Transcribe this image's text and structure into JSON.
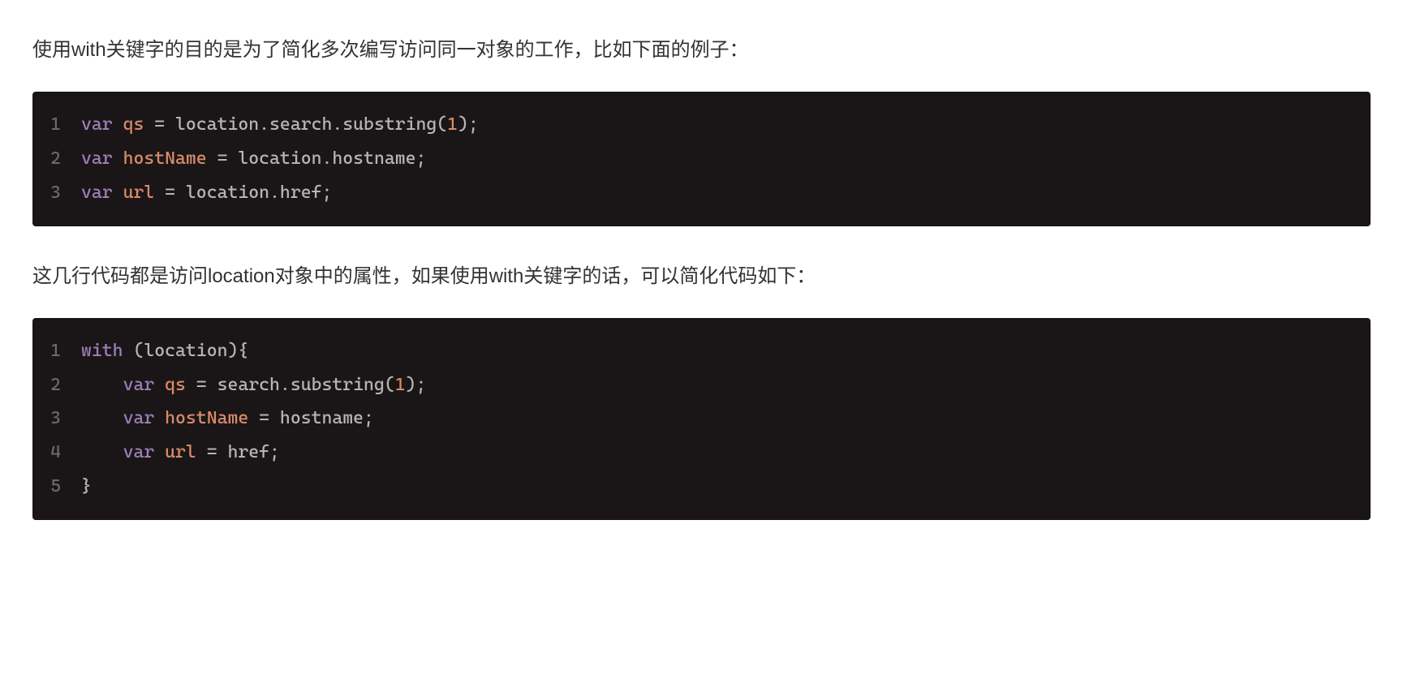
{
  "paragraphs": {
    "p1": "使用with关键字的目的是为了简化多次编写访问同一对象的工作，比如下面的例子：",
    "p2": "这几行代码都是访问location对象中的属性，如果使用with关键字的话，可以简化代码如下："
  },
  "codeblock1": {
    "lines": [
      {
        "num": "1",
        "tokens": [
          {
            "text": "var",
            "class": "keyword"
          },
          {
            "text": " ",
            "class": ""
          },
          {
            "text": "qs",
            "class": "variable"
          },
          {
            "text": " = location.search.substring(",
            "class": "punctuation"
          },
          {
            "text": "1",
            "class": "number"
          },
          {
            "text": ");",
            "class": "punctuation"
          }
        ]
      },
      {
        "num": "2",
        "tokens": [
          {
            "text": "var",
            "class": "keyword"
          },
          {
            "text": " ",
            "class": ""
          },
          {
            "text": "hostName",
            "class": "variable"
          },
          {
            "text": " = location.hostname;",
            "class": "punctuation"
          }
        ]
      },
      {
        "num": "3",
        "tokens": [
          {
            "text": "var",
            "class": "keyword"
          },
          {
            "text": " ",
            "class": ""
          },
          {
            "text": "url",
            "class": "variable"
          },
          {
            "text": " = location.href;",
            "class": "punctuation"
          }
        ]
      }
    ]
  },
  "codeblock2": {
    "lines": [
      {
        "num": "1",
        "tokens": [
          {
            "text": "with",
            "class": "keyword"
          },
          {
            "text": " (location){",
            "class": "punctuation"
          }
        ]
      },
      {
        "num": "2",
        "tokens": [
          {
            "text": "    ",
            "class": ""
          },
          {
            "text": "var",
            "class": "keyword"
          },
          {
            "text": " ",
            "class": ""
          },
          {
            "text": "qs",
            "class": "variable"
          },
          {
            "text": " = search.substring(",
            "class": "punctuation"
          },
          {
            "text": "1",
            "class": "number"
          },
          {
            "text": ");",
            "class": "punctuation"
          }
        ]
      },
      {
        "num": "3",
        "tokens": [
          {
            "text": "    ",
            "class": ""
          },
          {
            "text": "var",
            "class": "keyword"
          },
          {
            "text": " ",
            "class": ""
          },
          {
            "text": "hostName",
            "class": "variable"
          },
          {
            "text": " = hostname;",
            "class": "punctuation"
          }
        ]
      },
      {
        "num": "4",
        "tokens": [
          {
            "text": "    ",
            "class": ""
          },
          {
            "text": "var",
            "class": "keyword"
          },
          {
            "text": " ",
            "class": ""
          },
          {
            "text": "url",
            "class": "variable"
          },
          {
            "text": " = href;",
            "class": "punctuation"
          }
        ]
      },
      {
        "num": "5",
        "tokens": [
          {
            "text": "}",
            "class": "punctuation"
          }
        ]
      }
    ]
  }
}
